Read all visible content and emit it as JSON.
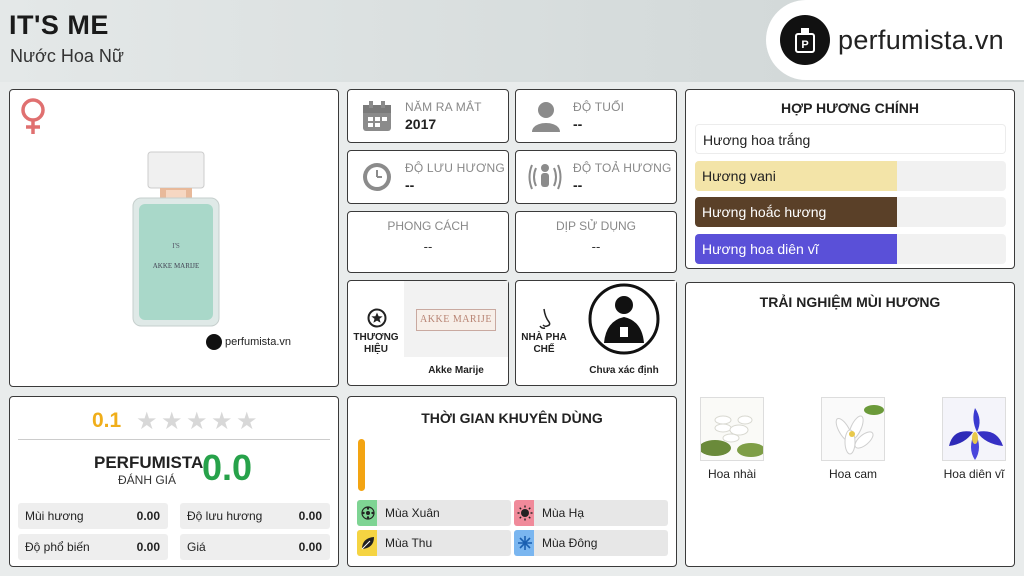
{
  "header": {
    "title": "IT'S ME",
    "subtitle": "Nước Hoa Nữ",
    "brand": "perfumista.vn"
  },
  "product": {
    "gender_icon": "female-symbol-icon",
    "watermark": "perfumista.vn"
  },
  "info": {
    "release_year": {
      "label": "NĂM RA MẮT",
      "value": "2017",
      "icon": "calendar-icon"
    },
    "age": {
      "label": "ĐỘ TUỔI",
      "value": "--",
      "icon": "person-icon"
    },
    "longevity": {
      "label": "ĐỘ LƯU HƯƠNG",
      "value": "--",
      "icon": "clock-icon"
    },
    "sillage": {
      "label": "ĐỘ TOẢ HƯƠNG",
      "value": "--",
      "icon": "radiating-person-icon"
    },
    "style": {
      "label": "PHONG CÁCH",
      "value": "--"
    },
    "occasion": {
      "label": "DỊP SỬ DỤNG",
      "value": "--"
    },
    "brand": {
      "label": "THƯƠNG HIỆU",
      "logo_text": "AKKE MARIJE",
      "caption": "Akke Marije",
      "icon": "star-badge-icon"
    },
    "perfumer": {
      "label": "NHÀ PHA CHẾ",
      "caption": "Chưa xác định",
      "icon": "nose-icon"
    }
  },
  "accords": {
    "title": "HỢP HƯƠNG CHÍNH",
    "items": [
      {
        "label": "Hương hoa trắng",
        "fraction": 1.0,
        "color": "#ffffff",
        "text_color": "#222222"
      },
      {
        "label": "Hương vani",
        "fraction": 0.65,
        "color": "#f3e4a8",
        "text_color": "#222222"
      },
      {
        "label": "Hương hoắc hương",
        "fraction": 0.65,
        "color": "#5a4028",
        "text_color": "#ffffff"
      },
      {
        "label": "Hương hoa diên vĩ",
        "fraction": 0.65,
        "color": "#5a50d8",
        "text_color": "#ffffff"
      }
    ]
  },
  "rating": {
    "score": "0.1",
    "stars_filled": 0,
    "stars_total": 5,
    "perfumista_label": "PERFUMISTA",
    "perfumista_sub": "ĐÁNH GIÁ",
    "perfumista_score": "0.0",
    "metrics": [
      {
        "label": "Mùi hương",
        "value": "0.00"
      },
      {
        "label": "Độ lưu hương",
        "value": "0.00"
      },
      {
        "label": "Độ phổ biến",
        "value": "0.00"
      },
      {
        "label": "Giá",
        "value": "0.00"
      }
    ]
  },
  "seasons": {
    "title": "THỜI GIAN KHUYÊN DÙNG",
    "items": [
      {
        "label": "Mùa Xuân",
        "color": "#7ed493",
        "icon": "spring-flower-icon"
      },
      {
        "label": "Mùa Hạ",
        "color": "#f08a9a",
        "icon": "sun-icon"
      },
      {
        "label": "Mùa Thu",
        "color": "#f5d442",
        "icon": "leaf-icon"
      },
      {
        "label": "Mùa Đông",
        "color": "#7ab6f0",
        "icon": "snowflake-icon"
      }
    ]
  },
  "notes": {
    "title": "TRẢI NGHIỆM MÙI HƯƠNG",
    "items": [
      {
        "label": "Hoa nhài",
        "icon": "jasmine-flower-icon"
      },
      {
        "label": "Hoa cam",
        "icon": "orange-blossom-icon"
      },
      {
        "label": "Hoa diên vĩ",
        "icon": "iris-flower-icon"
      }
    ]
  }
}
